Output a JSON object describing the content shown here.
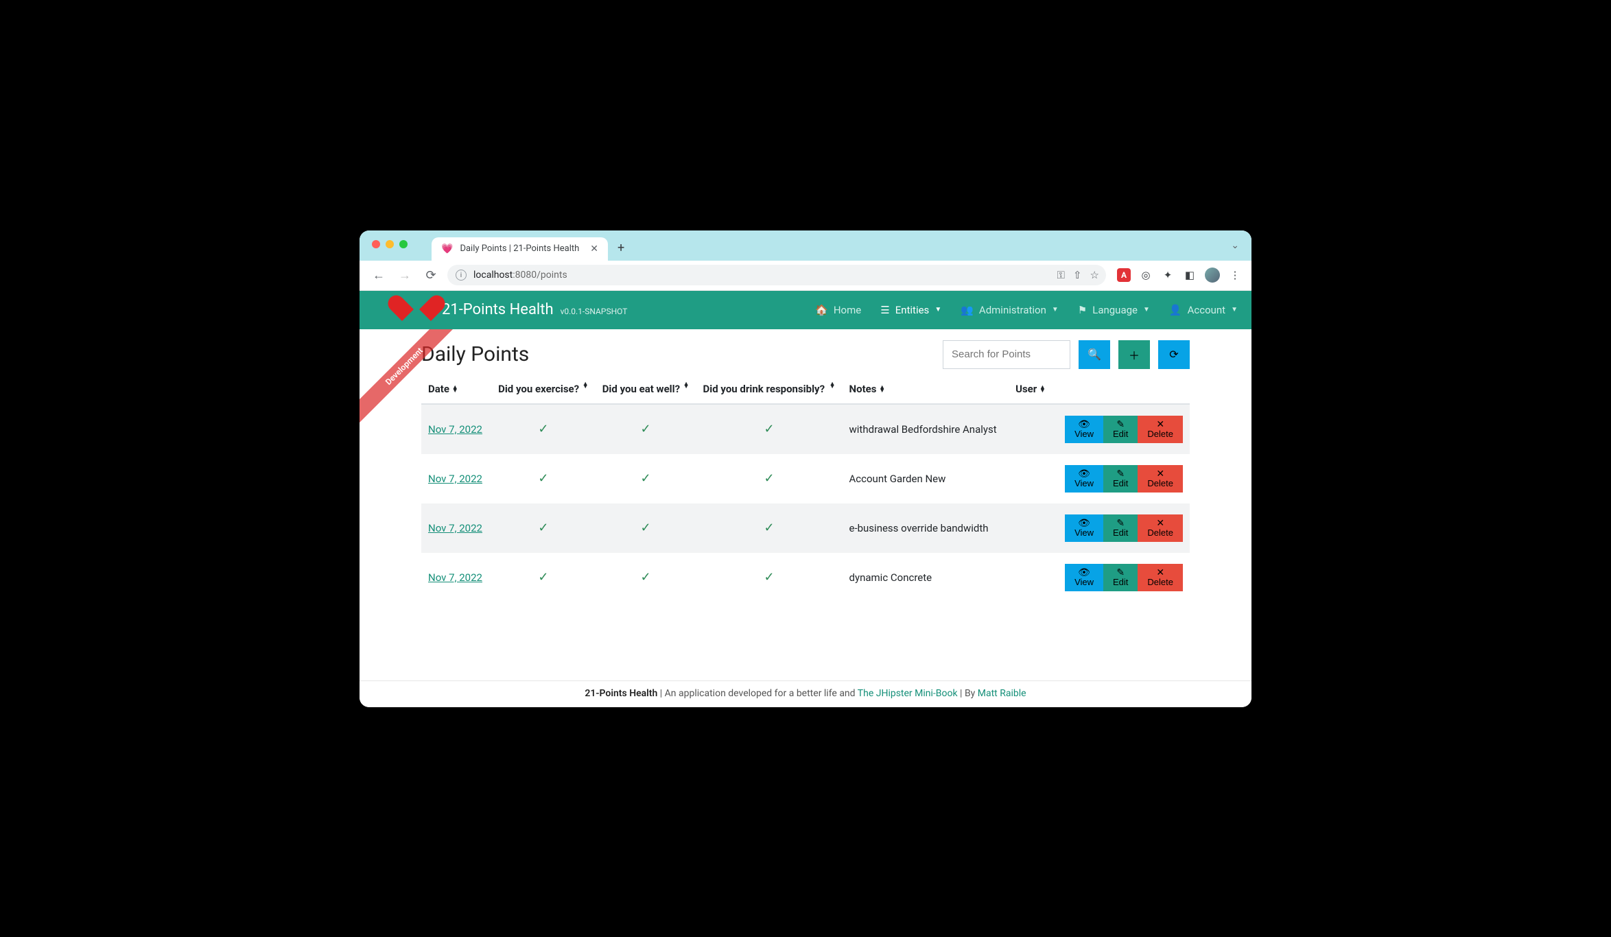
{
  "browser": {
    "tab_title": "Daily Points | 21-Points Health",
    "url_host": "localhost",
    "url_port": ":8080",
    "url_path": "/points"
  },
  "ribbon": "Development",
  "navbar": {
    "brand": "21-Points Health",
    "version": "v0.0.1-SNAPSHOT",
    "items": {
      "home": "Home",
      "entities": "Entities",
      "admin": "Administration",
      "language": "Language",
      "account": "Account"
    }
  },
  "page": {
    "title": "Daily Points",
    "search_placeholder": "Search for Points"
  },
  "columns": {
    "date": "Date",
    "exercise": "Did you exercise?",
    "eat": "Did you eat well?",
    "drink": "Did you drink responsibly?",
    "notes": "Notes",
    "user": "User"
  },
  "action_labels": {
    "view": "View",
    "edit": "Edit",
    "delete": "Delete"
  },
  "rows": [
    {
      "date": "Nov 7, 2022",
      "exercise": true,
      "eat": true,
      "drink": true,
      "notes": "withdrawal Bedfordshire Analyst",
      "user": ""
    },
    {
      "date": "Nov 7, 2022",
      "exercise": true,
      "eat": true,
      "drink": true,
      "notes": "Account Garden New",
      "user": ""
    },
    {
      "date": "Nov 7, 2022",
      "exercise": true,
      "eat": true,
      "drink": true,
      "notes": "e-business override bandwidth",
      "user": ""
    },
    {
      "date": "Nov 7, 2022",
      "exercise": true,
      "eat": true,
      "drink": true,
      "notes": "dynamic Concrete",
      "user": ""
    }
  ],
  "footer": {
    "app": "21-Points Health",
    "tagline": " | An application developed for a better life and ",
    "link1": "The JHipster Mini-Book",
    "by": " | By ",
    "link2": "Matt Raible"
  }
}
